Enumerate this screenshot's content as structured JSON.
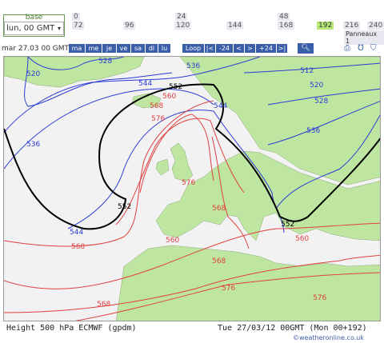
{
  "controls": {
    "base_label": "base",
    "base_select_value": "lun, 00 GMT",
    "hours_row1": [
      "0",
      "24",
      "48"
    ],
    "hours_row2": [
      "72",
      "96",
      "120",
      "144",
      "168",
      "192",
      "216",
      "240"
    ],
    "highlighted_hour": "192",
    "panneaux": "Panneaux 1"
  },
  "nav": {
    "date_label": "mar 27.03 00 GMT",
    "days": [
      "ma",
      "me",
      "je",
      "ve",
      "sa",
      "di",
      "lu"
    ],
    "loop": "Loop",
    "buttons": [
      "|<",
      "-24",
      "<",
      ">",
      "+24",
      ">|"
    ]
  },
  "map": {
    "contour_labels_blue": [
      "520",
      "528",
      "536",
      "536",
      "544",
      "512",
      "520",
      "528",
      "536",
      "544",
      "544"
    ],
    "contour_labels_black": [
      "552",
      "552",
      "552"
    ],
    "contour_labels_red": [
      "560",
      "568",
      "576",
      "576",
      "568",
      "560",
      "560",
      "568",
      "576",
      "576",
      "568",
      "560"
    ],
    "colors": {
      "land": "#bfe6a0",
      "sea": "#f2f2f2",
      "blue": "#2a3cd6",
      "red": "#e04040",
      "black": "#000000"
    }
  },
  "footer": {
    "left": "Height 500 hPa ECMWF (gpdm)",
    "right": "Tue 27/03/12 00GMT   (Mon 00+192)",
    "copyright": "©weatheronline.co.uk"
  }
}
